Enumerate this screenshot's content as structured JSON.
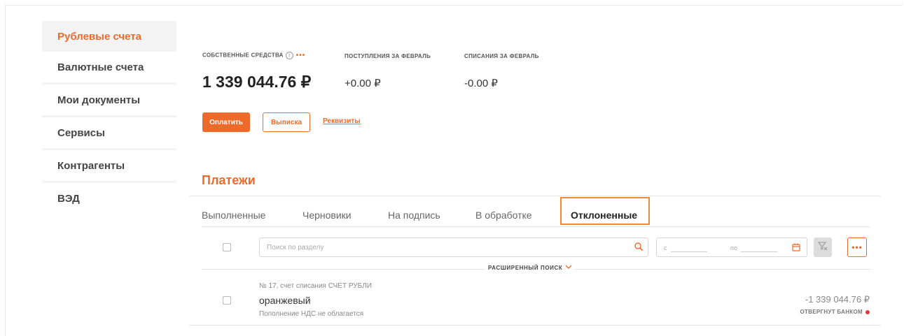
{
  "sidebar": {
    "items": [
      {
        "label": "Рублевые счета",
        "active": true
      },
      {
        "label": "Валютные счета",
        "active": false
      },
      {
        "label": "Мои документы",
        "active": false
      },
      {
        "label": "Сервисы",
        "active": false
      },
      {
        "label": "Контрагенты",
        "active": false
      },
      {
        "label": "ВЭД",
        "active": false
      }
    ]
  },
  "summary": {
    "own_funds_label": "СОБСТВЕННЫЕ СРЕДСТВА",
    "info_glyph": "i",
    "more_glyph": "•••",
    "income_label": "ПОСТУПЛЕНИЯ ЗА ФЕВРАЛЬ",
    "expense_label": "СПИСАНИЯ ЗА ФЕВРАЛЬ",
    "balance": "1 339 044.76 ₽",
    "income": "+0.00 ₽",
    "expense": "-0.00 ₽"
  },
  "actions": {
    "pay_label": "Оплатить",
    "statement_label": "Выписка",
    "requisites_label": "Реквизиты"
  },
  "payments": {
    "title": "Платежи",
    "tabs": [
      {
        "label": "Выполненные",
        "active": false
      },
      {
        "label": "Черновики",
        "active": false
      },
      {
        "label": "На подпись",
        "active": false
      },
      {
        "label": "В обработке",
        "active": false
      },
      {
        "label": "Отклоненные",
        "active": true
      }
    ],
    "search": {
      "placeholder": "Поиск по разделу",
      "date_from_label": "с",
      "date_to_label": "по",
      "more_glyph": "•••"
    },
    "advanced_search_label": "РАСШИРЕННЫЙ ПОИСК",
    "rows": [
      {
        "meta": "№ 17, счет списания СЧЕТ РУБЛИ",
        "title": "оранжевый",
        "subtitle": "Пополнение НДС не облагается",
        "amount": "-1 339 044.76 ₽",
        "status": "ОТВЕРГНУТ БАНКОМ"
      }
    ]
  },
  "colors": {
    "accent": "#ee6a2a",
    "sidebar_bg": "#f3f3f3",
    "status_error": "#e03b3b"
  }
}
